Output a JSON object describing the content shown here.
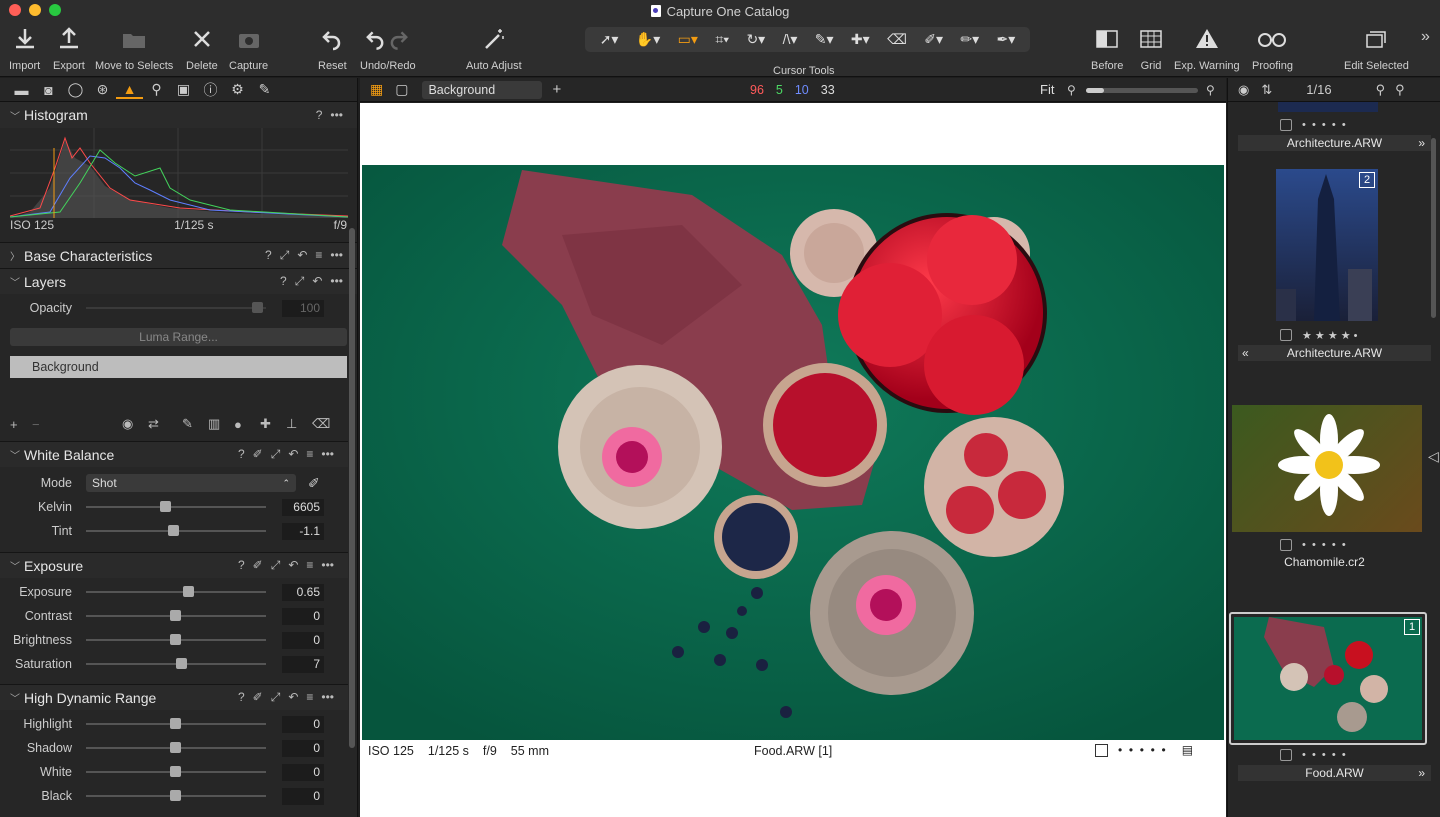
{
  "window": {
    "title": "Capture One Catalog"
  },
  "toolbar": {
    "import": "Import",
    "export": "Export",
    "move": "Move to Selects",
    "delete": "Delete",
    "capture": "Capture",
    "reset": "Reset",
    "undo": "Undo/Redo",
    "auto": "Auto Adjust",
    "cursor_tools": "Cursor Tools",
    "before": "Before",
    "grid": "Grid",
    "exp_warning": "Exp. Warning",
    "proofing": "Proofing",
    "edit_selected": "Edit Selected"
  },
  "histogram": {
    "title": "Histogram",
    "iso": "ISO 125",
    "shutter": "1/125 s",
    "aperture": "f/9"
  },
  "base": {
    "title": "Base Characteristics"
  },
  "layers": {
    "title": "Layers",
    "opacity_label": "Opacity",
    "opacity_value": "100",
    "luma": "Luma Range...",
    "layer_name": "Background",
    "opacity_level": 1.0
  },
  "white_balance": {
    "title": "White Balance",
    "mode_label": "Mode",
    "mode_value": "Shot",
    "kelvin_label": "Kelvin",
    "kelvin_value": "6605",
    "tint_label": "Tint",
    "tint_value": "-1.1"
  },
  "exposure": {
    "title": "Exposure",
    "rows": [
      {
        "label": "Exposure",
        "value": "0.65"
      },
      {
        "label": "Contrast",
        "value": "0"
      },
      {
        "label": "Brightness",
        "value": "0"
      },
      {
        "label": "Saturation",
        "value": "7"
      }
    ]
  },
  "hdr": {
    "title": "High Dynamic Range",
    "rows": [
      {
        "label": "Highlight",
        "value": "0"
      },
      {
        "label": "Shadow",
        "value": "0"
      },
      {
        "label": "White",
        "value": "0"
      },
      {
        "label": "Black",
        "value": "0"
      }
    ]
  },
  "viewer": {
    "layer_select": "Background",
    "count_red": "96",
    "count_green": "5",
    "count_blue": "10",
    "count_total": "33",
    "zoom": "Fit",
    "iso": "ISO 125",
    "shutter": "1/125 s",
    "aperture": "f/9",
    "focal": "55 mm",
    "filename": "Food.ARW [1]"
  },
  "browser": {
    "counter": "1/16",
    "thumbs": [
      {
        "name": "Architecture.ARW"
      },
      {
        "name": "Architecture.ARW",
        "badge": "2",
        "stars": "★ ★ ★ ★ •"
      },
      {
        "name": "Chamomile.cr2"
      },
      {
        "name": "Food.ARW",
        "badge": "1"
      }
    ]
  },
  "colors": {
    "accent": "#f39c12",
    "count_red": "#ff5a5a",
    "count_green": "#4cd964",
    "count_blue": "#6f8cff"
  }
}
